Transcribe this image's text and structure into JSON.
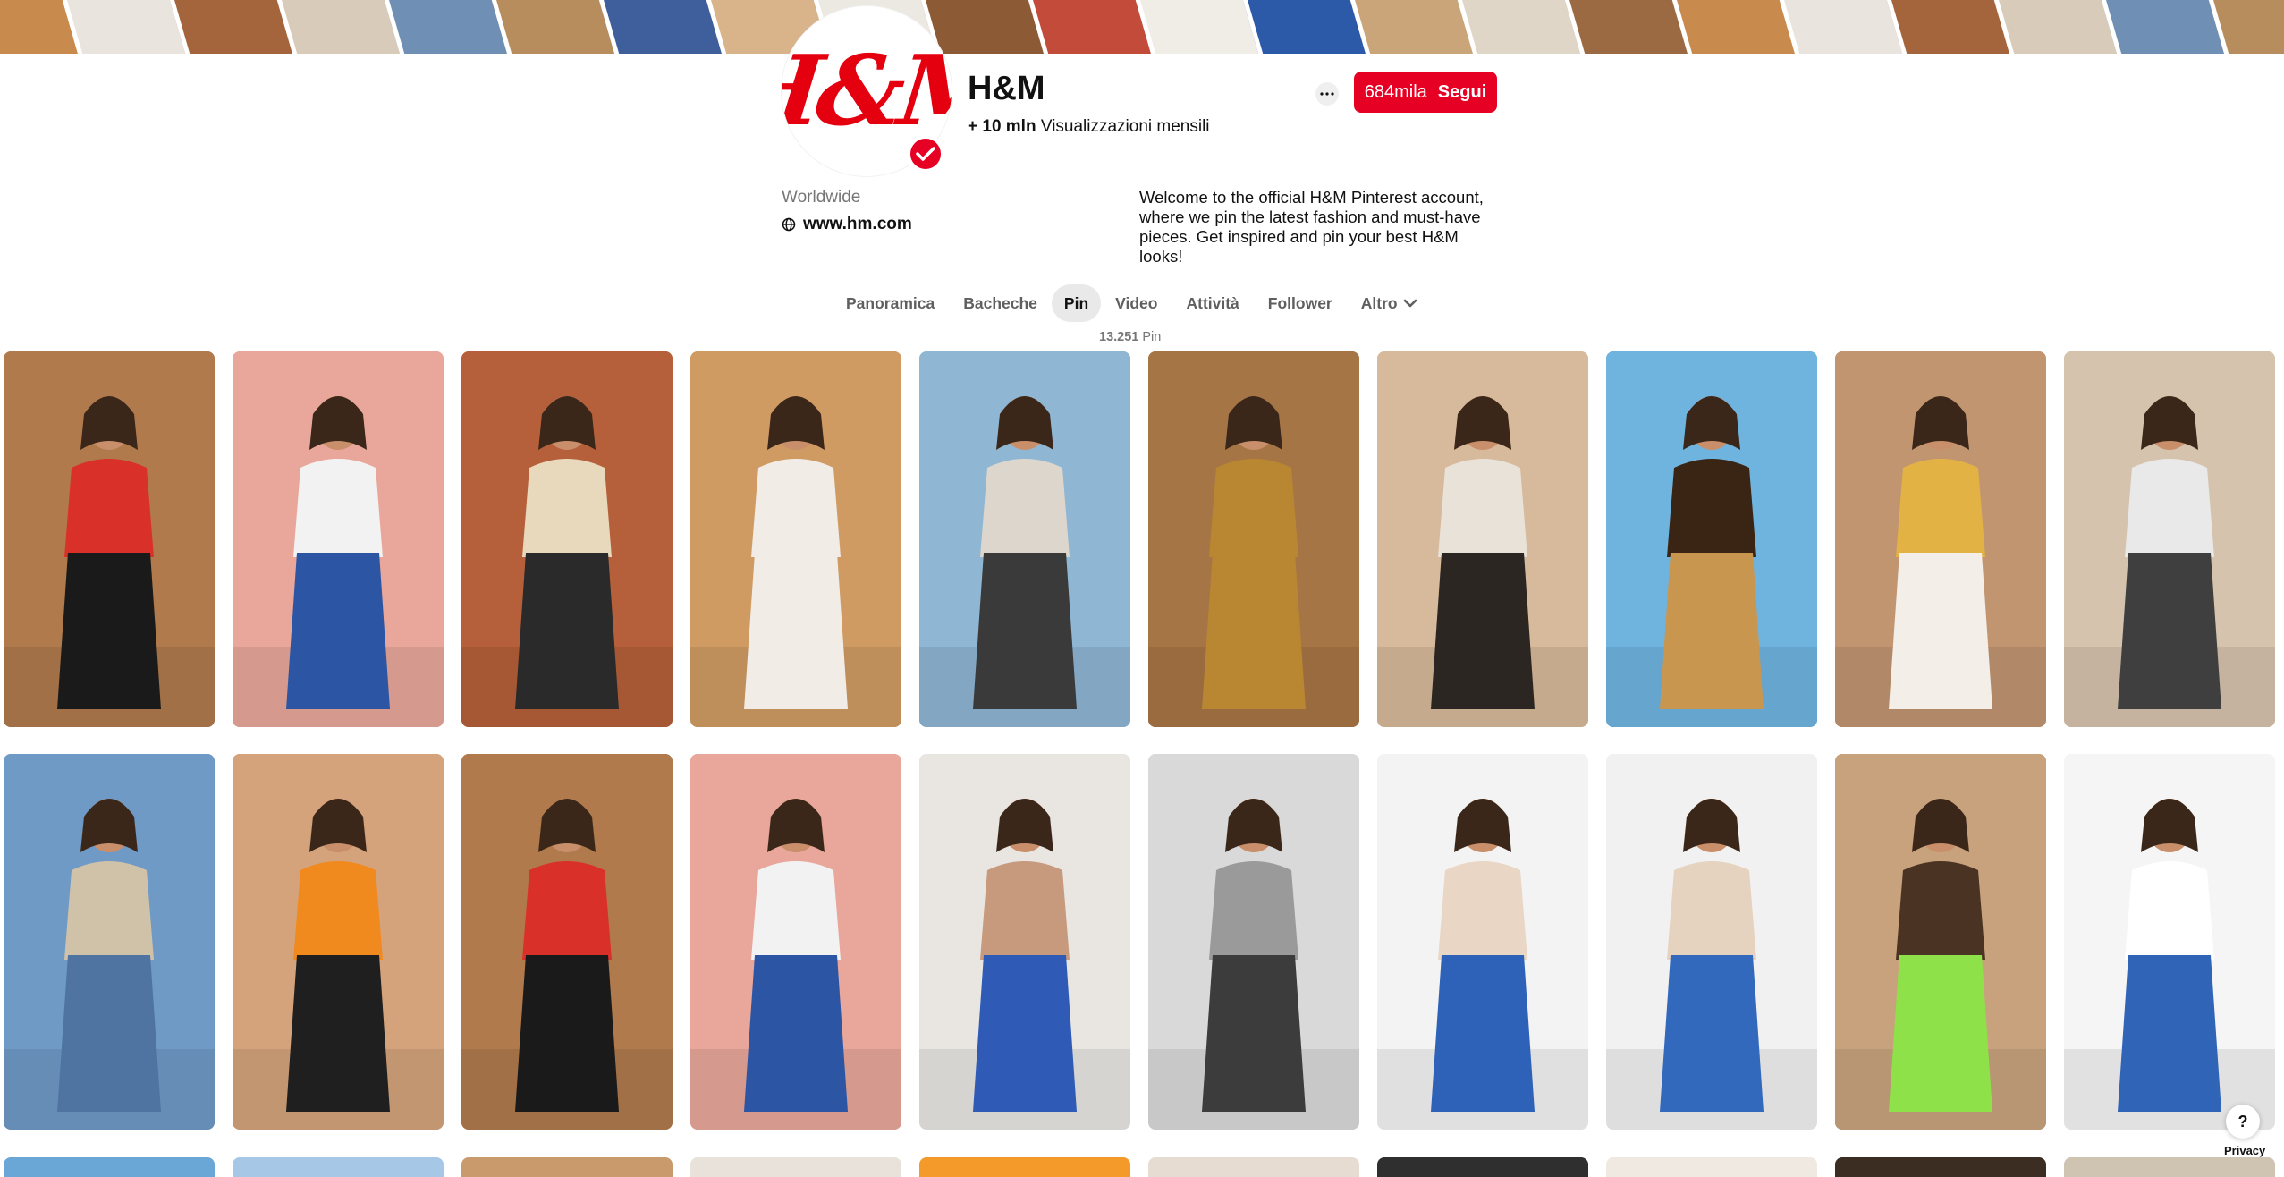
{
  "cover": {
    "tile_colors": [
      "#c98a4e",
      "#e9e4dd",
      "#a4653c",
      "#d8cbb9",
      "#6f8fb5",
      "#b88d5e",
      "#3e5f9c",
      "#d9b38a",
      "#ece8e2",
      "#8c5a35",
      "#c24b3a",
      "#f0ece6",
      "#2c5aa8",
      "#caa57a",
      "#e0d6c8",
      "#9b6a42"
    ]
  },
  "profile": {
    "logo_text": "H&M",
    "name": "H&M",
    "monthly_views_value": "+ 10 mln",
    "monthly_views_label": "Visualizzazioni mensili",
    "location": "Worldwide",
    "website": "www.hm.com",
    "bio": "Welcome to the official H&M Pinterest account, where we pin the latest fashion and must-have pieces. Get inspired and pin your best H&M looks!",
    "follower_count": "684mila",
    "follow_label": "Segui"
  },
  "tabs": [
    {
      "label": "Panoramica",
      "active": false
    },
    {
      "label": "Bacheche",
      "active": false
    },
    {
      "label": "Pin",
      "active": true
    },
    {
      "label": "Video",
      "active": false
    },
    {
      "label": "Attività",
      "active": false
    },
    {
      "label": "Follower",
      "active": false
    },
    {
      "label": "Altro",
      "active": false
    }
  ],
  "pin_count": {
    "value": "13.251",
    "label": "Pin"
  },
  "pins": {
    "row1": [
      {
        "bg": "#b07a4c",
        "fig": "#1a1a1a",
        "top": "#d9302a"
      },
      {
        "bg": "#e8a79a",
        "fig": "#2c55a4",
        "top": "#f2f2f2"
      },
      {
        "bg": "#b5603a",
        "fig": "#2a2a2a",
        "top": "#e8d9bd"
      },
      {
        "bg": "#cf9b63",
        "fig": "#f1ece6",
        "top": "#f1ece6"
      },
      {
        "bg": "#8fb6d3",
        "fig": "#3a3a3a",
        "top": "#ddd6cc"
      },
      {
        "bg": "#a67545",
        "fig": "#b98732",
        "top": "#b98732"
      },
      {
        "bg": "#d7b99b",
        "fig": "#2b2622",
        "top": "#e9e2d8"
      },
      {
        "bg": "#6fb4df",
        "fig": "#c9964f",
        "top": "#3a2515"
      },
      {
        "bg": "#c29571",
        "fig": "#f3eee7",
        "top": "#e2b344"
      },
      {
        "bg": "#d6c3ae",
        "fig": "#3f3f3f",
        "top": "#e9e9e9"
      }
    ],
    "row2": [
      {
        "bg": "#6f9ac6",
        "fig": "#4f74a1",
        "top": "#cfc2a8"
      },
      {
        "bg": "#d4a37c",
        "fig": "#1f1f1f",
        "top": "#f18a1e"
      },
      {
        "bg": "#b07a4c",
        "fig": "#1a1a1a",
        "top": "#d9302a"
      },
      {
        "bg": "#e8a79a",
        "fig": "#2c55a4",
        "top": "#f2f2f2"
      },
      {
        "bg": "#e9e6e2",
        "fig": "#2f5bb7",
        "top": "#c79a7e"
      },
      {
        "bg": "#d9d9d9",
        "fig": "#3c3c3c",
        "top": "#9a9a9a"
      },
      {
        "bg": "#f3f3f3",
        "fig": "#2d62b8",
        "top": "#e9d6c4"
      },
      {
        "bg": "#f1f1f1",
        "fig": "#3269bd",
        "top": "#e6d3bf"
      },
      {
        "bg": "#c8a27d",
        "fig": "#8fe14a",
        "top": "#4a3322"
      },
      {
        "bg": "#f5f5f5",
        "fig": "#3064b6",
        "top": "#ffffff"
      }
    ],
    "row3_colors": [
      "#6aa6d6",
      "#a7c7e7",
      "#c89a6c",
      "#e8e2da",
      "#f39a2b",
      "#e7dcd2",
      "#2f2f2f",
      "#efe9e1",
      "#3b2d22",
      "#cfc3b2"
    ]
  },
  "help_label": "?",
  "privacy_label": "Privacy",
  "colors": {
    "accent": "#e60023",
    "brand_red": "#e50010",
    "muted_text": "#767676"
  }
}
